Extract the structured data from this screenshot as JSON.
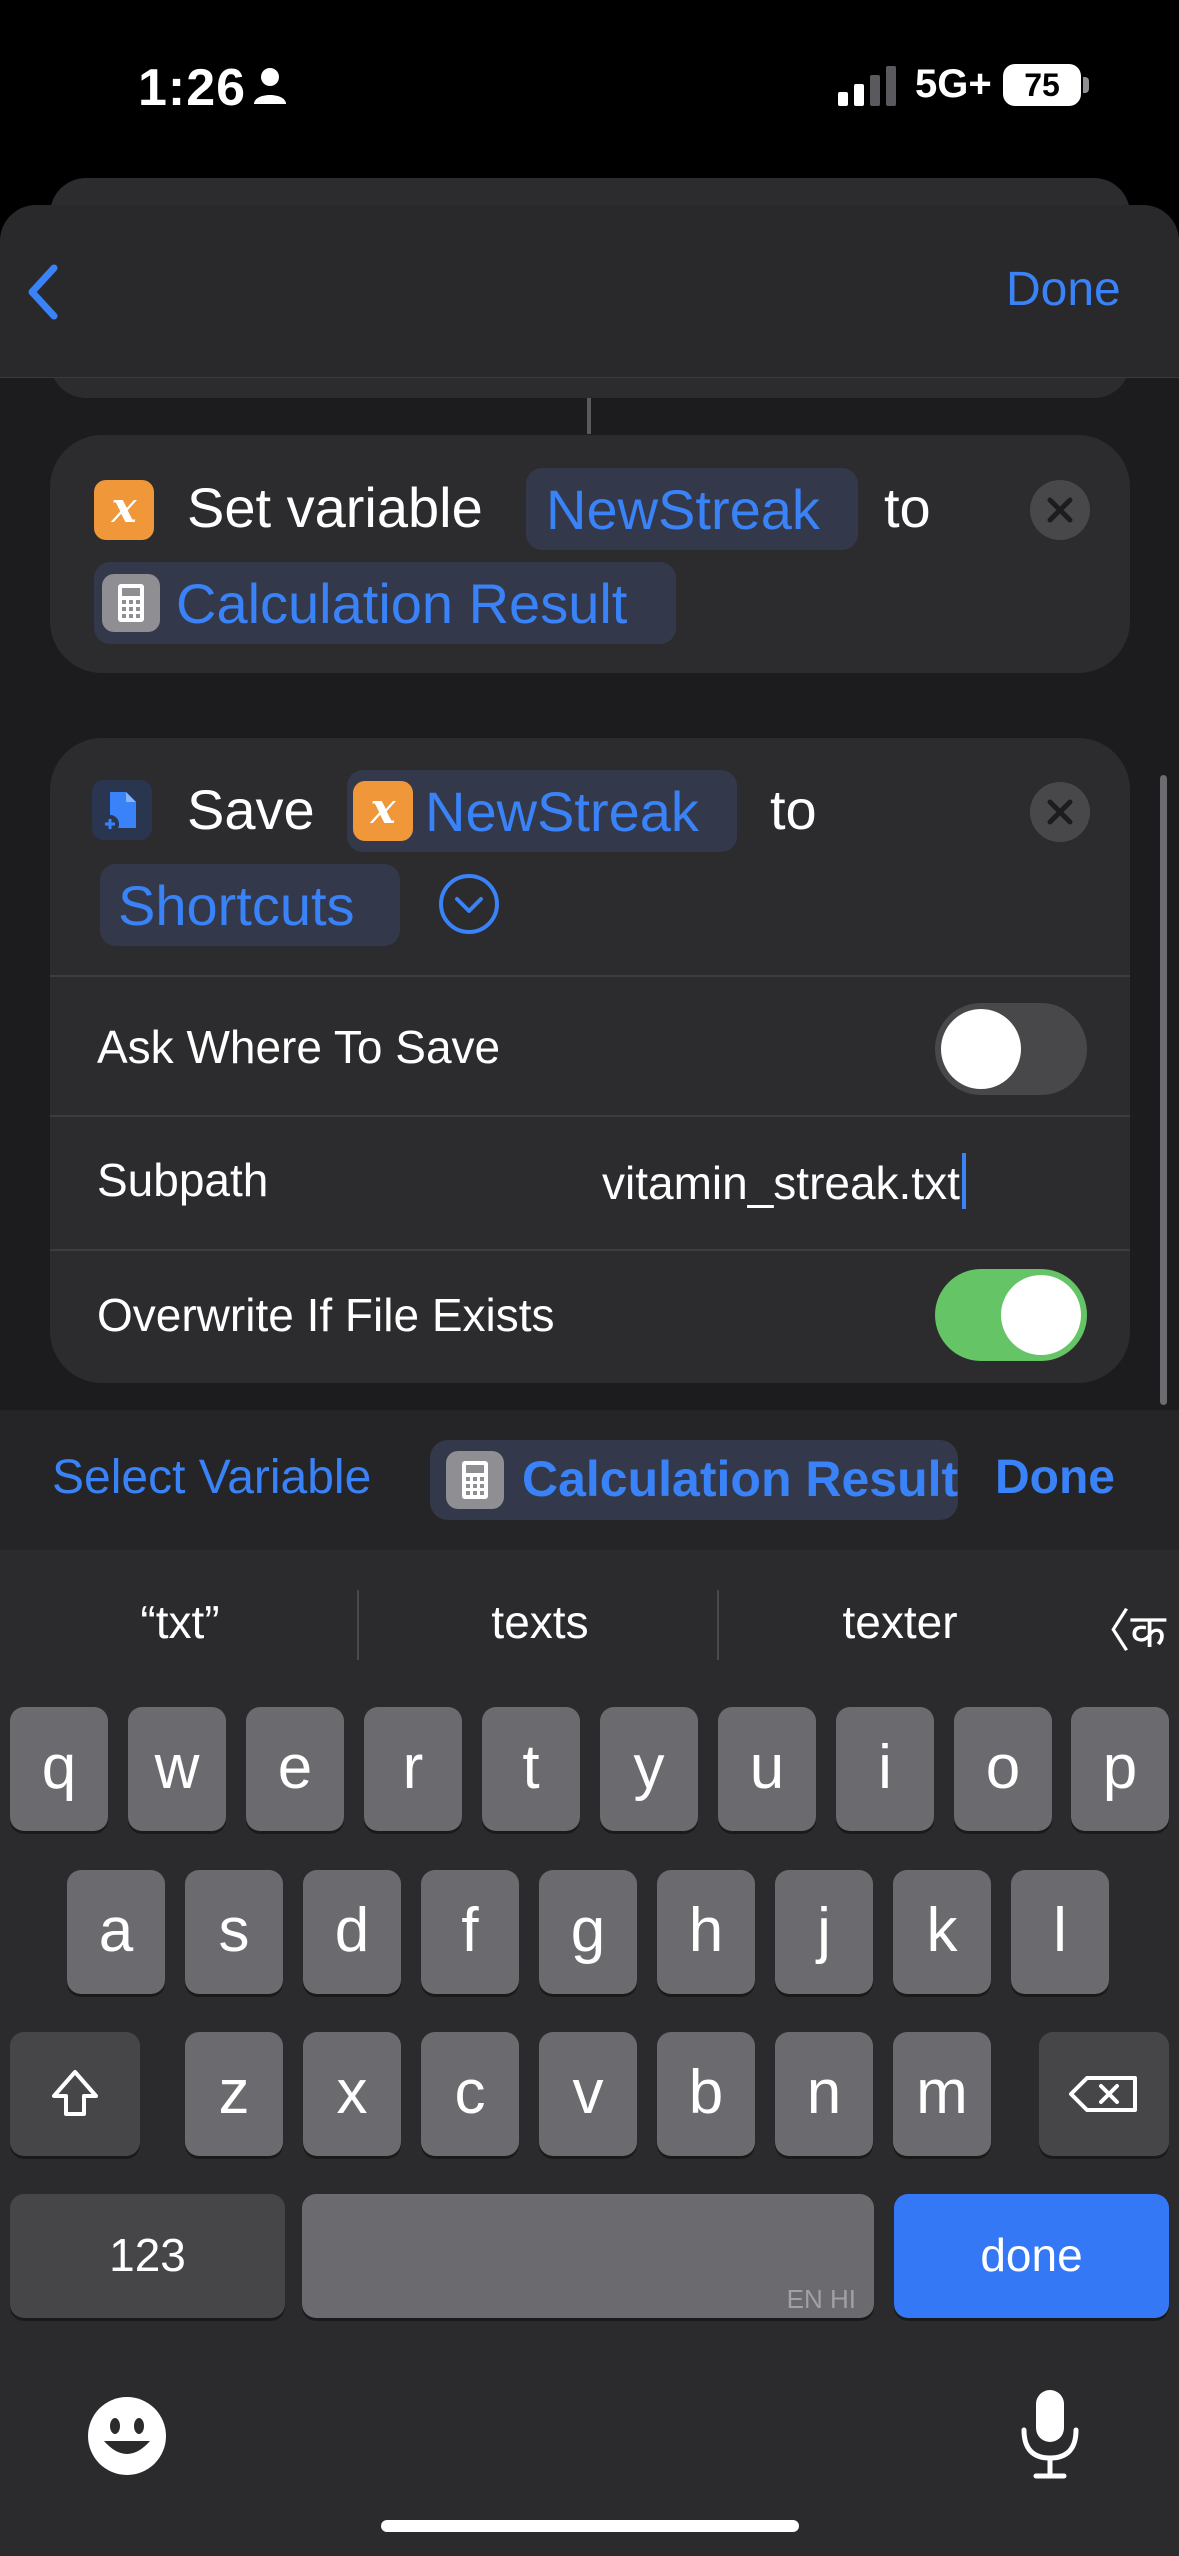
{
  "status": {
    "time": "1:26",
    "network": "5G+",
    "battery": "75"
  },
  "nav": {
    "done": "Done"
  },
  "set_variable": {
    "label": "Set variable",
    "variable": "NewStreak",
    "to": "to",
    "value": "Calculation Result"
  },
  "save_action": {
    "label": "Save",
    "variable": "NewStreak",
    "to": "to",
    "destination": "Shortcuts",
    "ask_where_label": "Ask Where To Save",
    "ask_where_on": false,
    "subpath_label": "Subpath",
    "subpath_value": "vitamin_streak.txt",
    "overwrite_label": "Overwrite If File Exists",
    "overwrite_on": true
  },
  "variable_bar": {
    "select_label": "Select Variable",
    "token": "Calculation Result",
    "done": "Done"
  },
  "keyboard": {
    "suggestions": [
      "“txt”",
      "texts",
      "texter"
    ],
    "lang_switch": "〈क",
    "row1": [
      "q",
      "w",
      "e",
      "r",
      "t",
      "y",
      "u",
      "i",
      "o",
      "p"
    ],
    "row2": [
      "a",
      "s",
      "d",
      "f",
      "g",
      "h",
      "j",
      "k",
      "l"
    ],
    "row3": [
      "z",
      "x",
      "c",
      "v",
      "b",
      "n",
      "m"
    ],
    "numbers_key": "123",
    "space_hint": "EN HI",
    "done_key": "done"
  },
  "colors": {
    "accent": "#3a82f7",
    "variable_orange": "#f0973a",
    "toggle_on": "#65c466"
  }
}
